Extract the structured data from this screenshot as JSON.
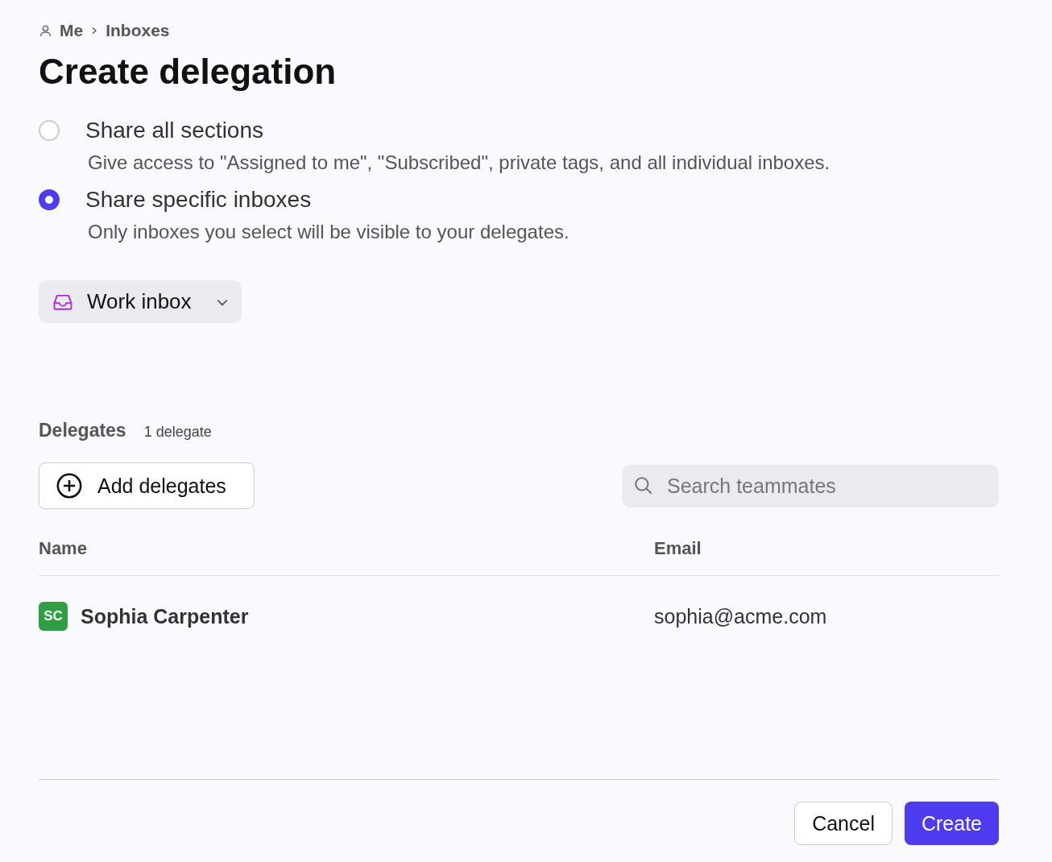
{
  "breadcrumb": [
    "Me",
    "Inboxes"
  ],
  "title": "Create delegation",
  "share_options": [
    {
      "label": "Share all sections",
      "description": "Give access to \"Assigned to me\", \"Subscribed\", private tags, and all individual inboxes.",
      "selected": false
    },
    {
      "label": "Share specific inboxes",
      "description": "Only inboxes you select will be visible to your delegates.",
      "selected": true
    }
  ],
  "inbox_select": {
    "value": "Work inbox"
  },
  "delegates": {
    "heading": "Delegates",
    "count": "1 delegate"
  },
  "add_button": "Add delegates",
  "search": {
    "placeholder": "Search teammates"
  },
  "table": {
    "columns": [
      "Name",
      "Email"
    ],
    "rows": [
      {
        "initials": "SC",
        "color": "#2f9e44",
        "name": "Sophia Carpenter",
        "email": "sophia@acme.com"
      }
    ]
  },
  "buttons": [
    {
      "label": "Cancel",
      "kind": "secondary"
    },
    {
      "label": "Create",
      "kind": "primary"
    }
  ]
}
